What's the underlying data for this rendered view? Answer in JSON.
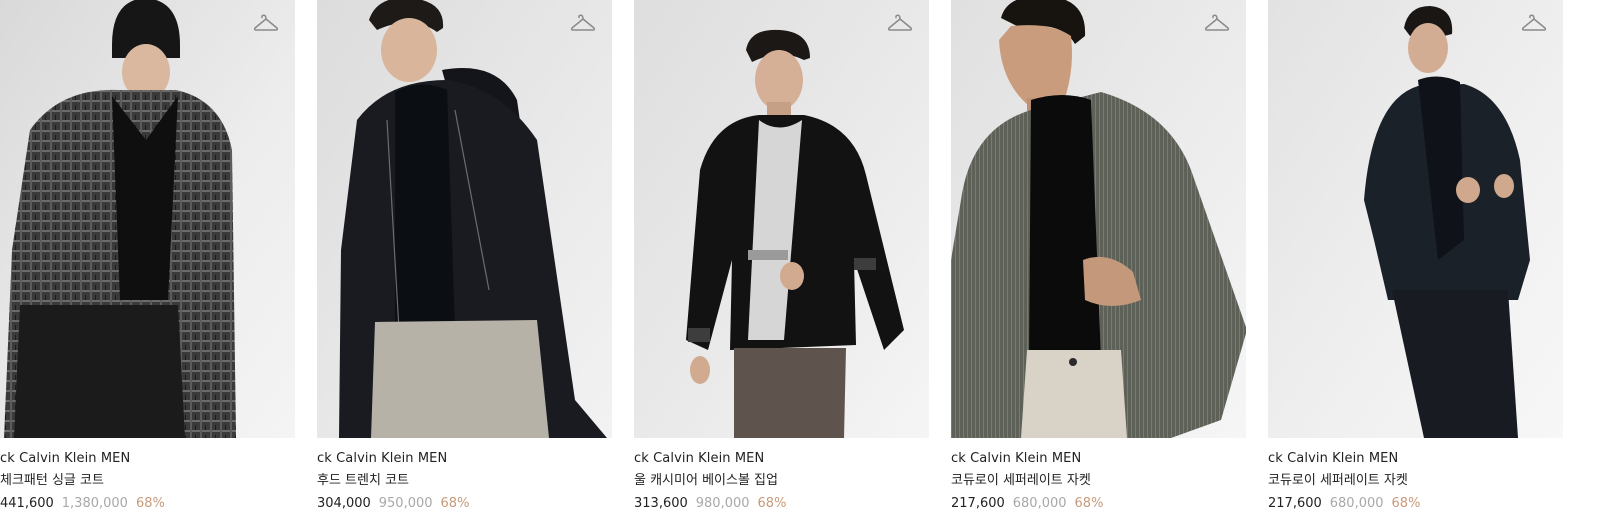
{
  "products": [
    {
      "brand": "ck Calvin Klein MEN",
      "name": "체크패턴 싱글 코트",
      "sale_price": "441,600",
      "original_price": "1,380,000",
      "discount": "68%",
      "wishlist_icon": "hanger-icon"
    },
    {
      "brand": "ck Calvin Klein MEN",
      "name": "후드 트렌치 코트",
      "sale_price": "304,000",
      "original_price": "950,000",
      "discount": "68%",
      "wishlist_icon": "hanger-icon"
    },
    {
      "brand": "ck Calvin Klein MEN",
      "name": "울 캐시미어 베이스볼 집업",
      "sale_price": "313,600",
      "original_price": "980,000",
      "discount": "68%",
      "wishlist_icon": "hanger-icon"
    },
    {
      "brand": "ck Calvin Klein MEN",
      "name": "코듀로이 세퍼레이트 자켓",
      "sale_price": "217,600",
      "original_price": "680,000",
      "discount": "68%",
      "wishlist_icon": "hanger-icon"
    },
    {
      "brand": "ck Calvin Klein MEN",
      "name": "코듀로이 세퍼레이트 자켓",
      "sale_price": "217,600",
      "original_price": "680,000",
      "discount": "68%",
      "wishlist_icon": "hanger-icon"
    }
  ],
  "colors": {
    "text": "#222222",
    "original_price": "#a8a8a8",
    "discount": "#c79a7b",
    "photo_background": "#e6e6e6"
  }
}
